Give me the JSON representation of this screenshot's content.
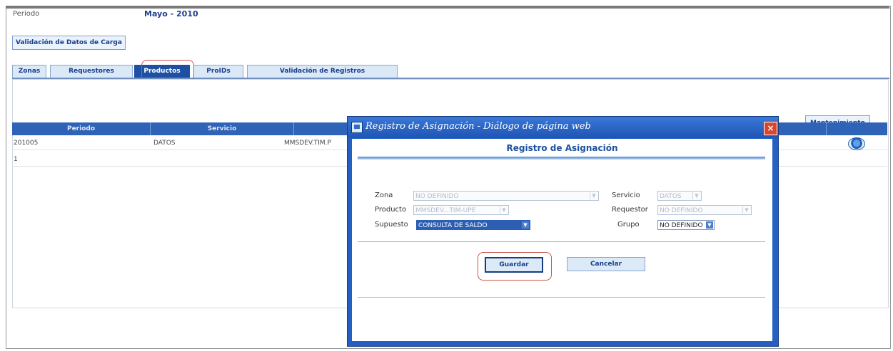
{
  "header": {
    "period_label": "Periodo",
    "period_value": "Mayo - 2010"
  },
  "toolbar": {
    "validation_button": "Validación de Datos de Carga",
    "maintenance_button": "Mantenimiento"
  },
  "tabs": [
    {
      "label": "Zonas",
      "active": false
    },
    {
      "label": "Requestores",
      "active": false
    },
    {
      "label": "Productos",
      "active": true
    },
    {
      "label": "ProIDs",
      "active": false
    },
    {
      "label": "Validación de Registros",
      "active": false
    }
  ],
  "grid": {
    "headers": [
      "Periodo",
      "Servicio"
    ],
    "row": {
      "periodo": "201005",
      "servicio": "DATOS",
      "producto": "MMSDEV.TIM.P"
    },
    "pager": "1"
  },
  "dialog": {
    "title": "Registro de Asignación - Diálogo de página web",
    "heading": "Registro de Asignación",
    "fields": {
      "zona": {
        "label": "Zona",
        "value": "NO DEFINIDO"
      },
      "servicio": {
        "label": "Servicio",
        "value": "DATOS"
      },
      "producto": {
        "label": "Producto",
        "value": "MMSDEV...TIM-UPE"
      },
      "requestor": {
        "label": "Requestor",
        "value": "NO DEFINIDO"
      },
      "supuesto": {
        "label": "Supuesto",
        "value": "CONSULTA DE SALDO"
      },
      "grupo": {
        "label": "Grupo",
        "value": "NO DEFINIDO"
      }
    },
    "save_label": "Guardar",
    "cancel_label": "Cancelar",
    "close_glyph": "×"
  },
  "colors": {
    "header_blue": "#2f63b8",
    "active_tab": "#1d50a3",
    "highlight": "#c9534a",
    "dialog_frame": "#2460c4"
  },
  "icons": [
    "window-icon",
    "close-icon",
    "edit-icon",
    "dropdown-arrow-icon"
  ]
}
